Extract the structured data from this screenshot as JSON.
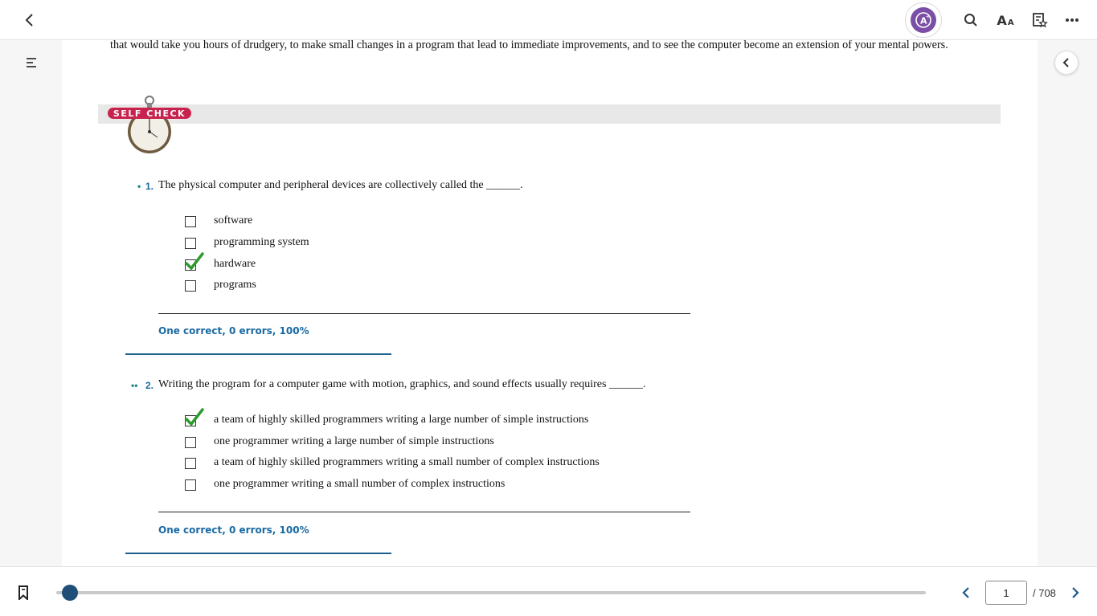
{
  "toolbar": {
    "back_icon": "chevron-left-icon",
    "assistant_icon": "ai-assistant-icon",
    "search_icon": "search-icon",
    "font_icon": "font-size-icon",
    "font_label_big": "A",
    "font_label_small": "A",
    "favorites_icon": "add-to-favorites-icon",
    "more_icon": "more-options-icon",
    "accent_color": "#7b4fa6"
  },
  "sidebar": {
    "toc_icon": "table-of-contents-icon",
    "collapse_icon": "chevron-left-icon"
  },
  "content": {
    "intro": "that would take you hours of drudgery, to make small changes in a program that lead to immediate improvements, and to see the computer become an extension of your mental powers.",
    "self_check_label": "SELF CHECK",
    "questions": [
      {
        "difficulty": "•",
        "number": "1.",
        "text": "The physical computer and peripheral devices are collectively called the ______.",
        "options": [
          {
            "label": "software",
            "checked": false
          },
          {
            "label": "programming system",
            "checked": false
          },
          {
            "label": "hardware",
            "checked": true
          },
          {
            "label": "programs",
            "checked": false
          }
        ],
        "result": "One correct, 0 errors, 100%"
      },
      {
        "difficulty": "••",
        "number": "2.",
        "text": "Writing the program for a computer game with motion, graphics, and sound effects usually requires ______.",
        "options": [
          {
            "label": "a team of highly skilled programmers writing a large number of simple instructions",
            "checked": true
          },
          {
            "label": "one programmer writing a large number of simple instructions",
            "checked": false
          },
          {
            "label": "a team of highly skilled programmers writing a small number of complex instructions",
            "checked": false
          },
          {
            "label": "one programmer writing a small number of complex instructions",
            "checked": false
          }
        ],
        "result": "One correct, 0 errors, 100%"
      }
    ]
  },
  "footer": {
    "bookmark_icon": "bookmark-icon",
    "progress_fraction": 0.0014,
    "page_value": "1",
    "page_total": "/ 708",
    "prev_icon": "chevron-left-icon",
    "next_icon": "chevron-right-icon"
  }
}
